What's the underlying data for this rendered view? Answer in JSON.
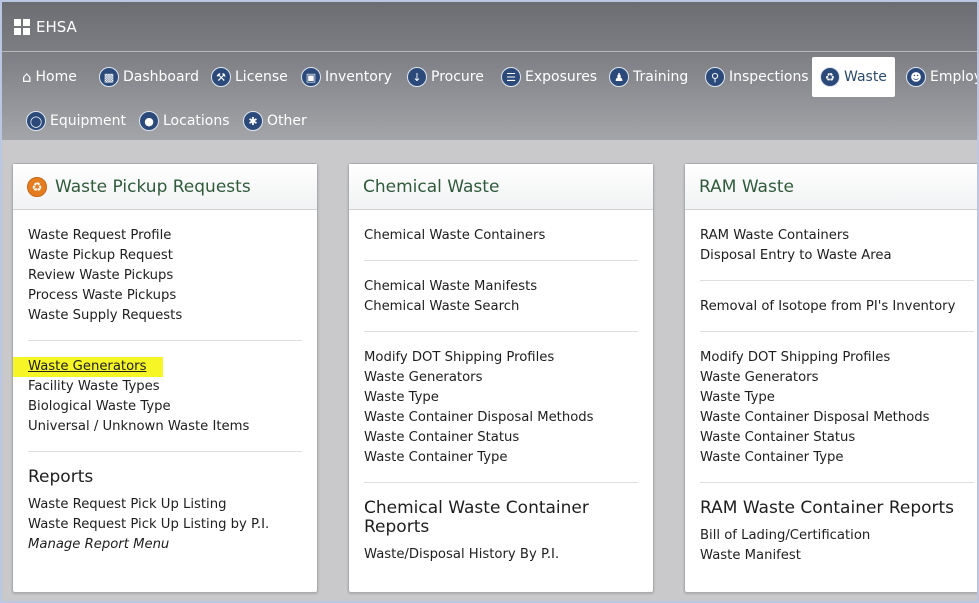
{
  "app": {
    "title": "EHSA"
  },
  "nav": {
    "row1": [
      {
        "label": "Home",
        "icon": "home-icon"
      },
      {
        "label": "Dashboard",
        "icon": "dashboard-icon"
      },
      {
        "label": "License",
        "icon": "wrench-icon"
      },
      {
        "label": "Inventory",
        "icon": "truck-icon"
      },
      {
        "label": "Procure",
        "icon": "arrow-down-icon"
      },
      {
        "label": "Exposures",
        "icon": "clipboard-icon"
      },
      {
        "label": "Training",
        "icon": "person-icon"
      },
      {
        "label": "Inspections",
        "icon": "magnifier-icon"
      },
      {
        "label": "Waste",
        "icon": "trash-icon",
        "active": true
      },
      {
        "label": "Employ",
        "icon": "people-icon"
      }
    ],
    "row2": [
      {
        "label": "Equipment",
        "icon": "gauge-icon"
      },
      {
        "label": "Locations",
        "icon": "map-pin-icon"
      },
      {
        "label": "Other",
        "icon": "asterisk-icon"
      }
    ]
  },
  "cards": {
    "pickup": {
      "title": "Waste Pickup Requests",
      "group1": [
        "Waste Request Profile",
        "Waste Pickup Request",
        "Review Waste Pickups",
        "Process Waste Pickups",
        "Waste Supply Requests"
      ],
      "group2": [
        "Waste Generators",
        "Facility Waste Types",
        "Biological Waste Type",
        "Universal / Unknown Waste Items"
      ],
      "reports_title": "Reports",
      "reports": [
        "Waste Request Pick Up Listing",
        "Waste Request Pick Up Listing by P.I.",
        "Manage Report Menu"
      ]
    },
    "chemical": {
      "title": "Chemical Waste",
      "group1": [
        "Chemical Waste Containers"
      ],
      "group2": [
        "Chemical Waste Manifests",
        "Chemical Waste Search"
      ],
      "group3": [
        "Modify DOT Shipping Profiles",
        "Waste Generators",
        "Waste Type",
        "Waste Container Disposal Methods",
        "Waste Container Status",
        "Waste Container Type"
      ],
      "reports_title": "Chemical Waste Container Reports",
      "reports": [
        "Waste/Disposal History By P.I."
      ]
    },
    "ram": {
      "title": "RAM Waste",
      "group1": [
        "RAM Waste Containers",
        "Disposal Entry to Waste Area"
      ],
      "group2": [
        "Removal of Isotope from PI's Inventory"
      ],
      "group3": [
        "Modify DOT Shipping Profiles",
        "Waste Generators",
        "Waste Type",
        "Waste Container Disposal Methods",
        "Waste Container Status",
        "Waste Container Type"
      ],
      "reports_title": "RAM Waste Container Reports",
      "reports": [
        "Bill of Lading/Certification",
        "Waste Manifest"
      ]
    }
  }
}
